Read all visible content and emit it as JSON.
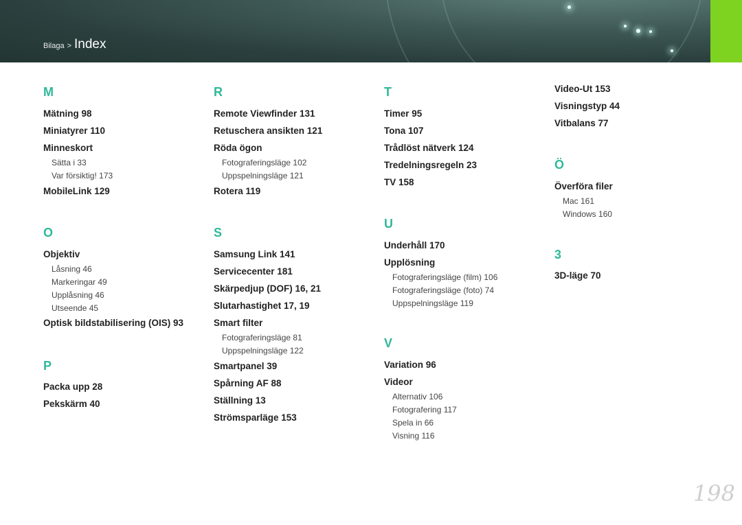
{
  "header": {
    "section": "Bilaga",
    "separator": ">",
    "title": "Index"
  },
  "page_number": "198",
  "columns": [
    [
      {
        "t": "letter",
        "text": "M"
      },
      {
        "t": "main",
        "text": "Mätning  98"
      },
      {
        "t": "main",
        "text": "Miniatyrer  110"
      },
      {
        "t": "main",
        "text": "Minneskort"
      },
      {
        "t": "sub",
        "text": "Sätta i  33"
      },
      {
        "t": "sub",
        "text": "Var försiktig!  173"
      },
      {
        "t": "main",
        "text": "MobileLink  129"
      },
      {
        "t": "letter",
        "text": "O"
      },
      {
        "t": "main",
        "text": "Objektiv"
      },
      {
        "t": "sub",
        "text": "Låsning  46"
      },
      {
        "t": "sub",
        "text": "Markeringar  49"
      },
      {
        "t": "sub",
        "text": "Upplåsning  46"
      },
      {
        "t": "sub",
        "text": "Utseende  45"
      },
      {
        "t": "main",
        "text": "Optisk bildstabilisering (OIS)  93"
      },
      {
        "t": "letter",
        "text": "P"
      },
      {
        "t": "main",
        "text": "Packa upp  28"
      },
      {
        "t": "main",
        "text": "Pekskärm  40"
      }
    ],
    [
      {
        "t": "letter",
        "text": "R"
      },
      {
        "t": "main",
        "text": "Remote Viewfinder  131"
      },
      {
        "t": "main",
        "text": "Retuschera ansikten  121"
      },
      {
        "t": "main",
        "text": "Röda ögon"
      },
      {
        "t": "sub",
        "text": "Fotograferingsläge  102"
      },
      {
        "t": "sub",
        "text": "Uppspelningsläge  121"
      },
      {
        "t": "main",
        "text": "Rotera  119"
      },
      {
        "t": "letter",
        "text": "S"
      },
      {
        "t": "main",
        "text": "Samsung Link  141"
      },
      {
        "t": "main",
        "text": "Servicecenter  181"
      },
      {
        "t": "main",
        "text": "Skärpedjup (DOF)  16, 21"
      },
      {
        "t": "main",
        "text": "Slutarhastighet  17, 19"
      },
      {
        "t": "main",
        "text": "Smart filter"
      },
      {
        "t": "sub",
        "text": "Fotograferingsläge  81"
      },
      {
        "t": "sub",
        "text": "Uppspelningsläge  122"
      },
      {
        "t": "main",
        "text": "Smartpanel  39"
      },
      {
        "t": "main",
        "text": "Spårning AF  88"
      },
      {
        "t": "main",
        "text": "Ställning  13"
      },
      {
        "t": "main",
        "text": "Strömsparläge  153"
      }
    ],
    [
      {
        "t": "letter",
        "text": "T"
      },
      {
        "t": "main",
        "text": "Timer  95"
      },
      {
        "t": "main",
        "text": "Tona  107"
      },
      {
        "t": "main",
        "text": "Trådlöst nätverk  124"
      },
      {
        "t": "main",
        "text": "Tredelningsregeln  23"
      },
      {
        "t": "main",
        "text": "TV  158"
      },
      {
        "t": "letter",
        "text": "U"
      },
      {
        "t": "main",
        "text": "Underhåll  170"
      },
      {
        "t": "main",
        "text": "Upplösning"
      },
      {
        "t": "sub",
        "text": "Fotograferingsläge (film)  106"
      },
      {
        "t": "sub",
        "text": "Fotograferingsläge (foto)  74"
      },
      {
        "t": "sub",
        "text": "Uppspelningsläge  119"
      },
      {
        "t": "letter",
        "text": "V"
      },
      {
        "t": "main",
        "text": "Variation  96"
      },
      {
        "t": "main",
        "text": "Videor"
      },
      {
        "t": "sub",
        "text": "Alternativ  106"
      },
      {
        "t": "sub",
        "text": "Fotografering  117"
      },
      {
        "t": "sub",
        "text": "Spela in  66"
      },
      {
        "t": "sub",
        "text": "Visning  116"
      }
    ],
    [
      {
        "t": "main",
        "text": "Video-Ut  153"
      },
      {
        "t": "main",
        "text": "Visningstyp  44"
      },
      {
        "t": "main",
        "text": "Vitbalans  77"
      },
      {
        "t": "letter",
        "text": "Ö"
      },
      {
        "t": "main",
        "text": "Överföra filer"
      },
      {
        "t": "sub",
        "text": "Mac  161"
      },
      {
        "t": "sub",
        "text": "Windows  160"
      },
      {
        "t": "letter",
        "text": "3"
      },
      {
        "t": "main",
        "text": "3D-läge  70"
      }
    ]
  ]
}
